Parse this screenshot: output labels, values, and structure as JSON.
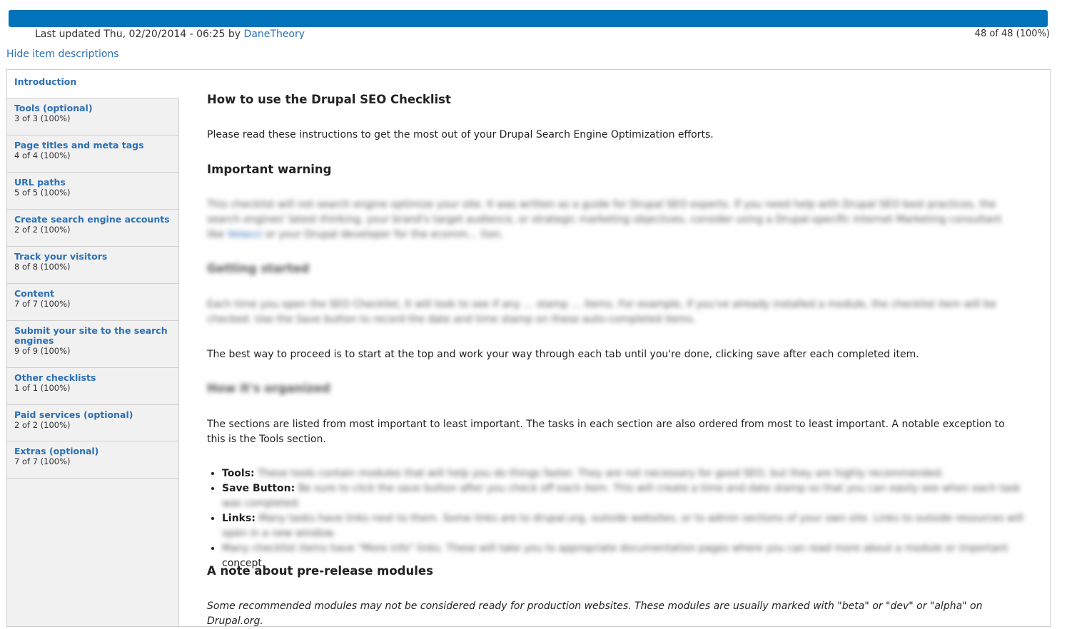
{
  "progress": {
    "fraction": 1.0,
    "count_text": "48 of 48 (100%)"
  },
  "meta": {
    "prefix": "Last updated Thu, 02/20/2014 - 06:25 by",
    "author": "DaneTheory"
  },
  "toggle_descriptions": "Hide item descriptions",
  "tabs": [
    {
      "label": "Introduction",
      "summary": ""
    },
    {
      "label": "Tools (optional)",
      "summary": "3 of 3 (100%)"
    },
    {
      "label": "Page titles and meta tags",
      "summary": "4 of 4 (100%)"
    },
    {
      "label": "URL paths",
      "summary": "5 of 5 (100%)"
    },
    {
      "label": "Create search engine accounts",
      "summary": "2 of 2 (100%)"
    },
    {
      "label": "Track your visitors",
      "summary": "8 of 8 (100%)"
    },
    {
      "label": "Content",
      "summary": "7 of 7 (100%)"
    },
    {
      "label": "Submit your site to the search engines",
      "summary": "9 of 9 (100%)"
    },
    {
      "label": "Other checklists",
      "summary": "1 of 1 (100%)"
    },
    {
      "label": "Paid services (optional)",
      "summary": "2 of 2 (100%)"
    },
    {
      "label": "Extras (optional)",
      "summary": "7 of 7 (100%)"
    }
  ],
  "content": {
    "title": "How to use the Drupal SEO Checklist",
    "intro": "Please read these instructions to get the most out of your Drupal Search Engine Optimization efforts.",
    "warning_heading": "Important warning",
    "warning_text_tail": "ecomm… tion.",
    "para2_tail": "It will look to see if any … stamp … items.",
    "best_way": "The best way to proceed is to start at the top and work your way through each tab until you're done, clicking save after each completed item.",
    "sections_text": "The sections are listed from most important to least important. The tasks in each section are also ordered from most to least important. A notable exception to this is the Tools section.",
    "bullets": [
      {
        "label": "Tools:",
        "text": ""
      },
      {
        "label": "Save Button:",
        "text": ""
      },
      {
        "label": "Links:",
        "text": ""
      },
      {
        "label": "",
        "text": "concept."
      }
    ],
    "prerelease_heading": "A note about pre-release modules",
    "prerelease_text": "Some recommended modules may not be considered ready for production websites. These modules are usually marked with \"beta\" or \"dev\" or \"alpha\" on Drupal.org."
  }
}
